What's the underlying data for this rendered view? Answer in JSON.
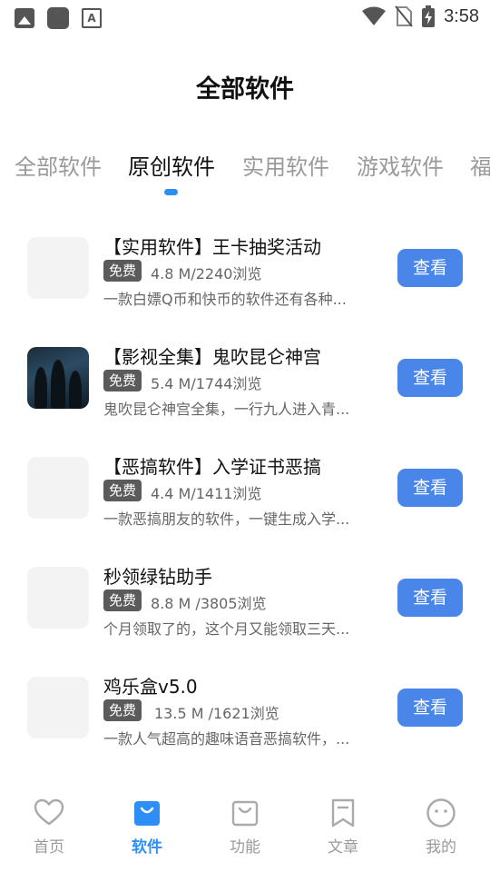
{
  "status_bar": {
    "time": "3:58",
    "left_icons": [
      "image-icon",
      "square-icon",
      "font-icon"
    ],
    "right_icons": [
      "wifi-icon",
      "no-sim-icon",
      "battery-charging-icon"
    ]
  },
  "header": {
    "title": "全部软件"
  },
  "tabs": [
    {
      "label": "全部软件"
    },
    {
      "label": "原创软件",
      "active": true
    },
    {
      "label": "实用软件"
    },
    {
      "label": "游戏软件"
    },
    {
      "label": "福"
    }
  ],
  "items": [
    {
      "title": "【实用软件】王卡抽奖活动",
      "badge": "免费",
      "meta": "4.8 M/2240浏览",
      "desc": "一款白嫖Q币和快币的软件还有各种...",
      "button": "查看",
      "thumb": "placeholder"
    },
    {
      "title": "【影视全集】鬼吹昆仑神宫",
      "badge": "免费",
      "meta": "5.4 M/1744浏览",
      "desc": "鬼吹昆仑神宫全集，一行九人进入青...",
      "button": "查看",
      "thumb": "poster"
    },
    {
      "title": "【恶搞软件】入学证书恶搞",
      "badge": "免费",
      "meta": "4.4 M/1411浏览",
      "desc": "一款恶搞朋友的软件，一键生成入学...",
      "button": "查看",
      "thumb": "placeholder"
    },
    {
      "title": "秒领绿钻助手",
      "badge": "免费",
      "meta": "8.8 M /3805浏览",
      "desc": "个月领取了的，这个月又能领取三天...",
      "button": "查看",
      "thumb": "placeholder"
    },
    {
      "title": "鸡乐盒v5.0",
      "badge": "免费",
      "meta": "13.5 M /1621浏览",
      "desc": "一款人气超高的趣味语音恶搞软件，...",
      "button": "查看",
      "thumb": "placeholder"
    }
  ],
  "bottom_nav": [
    {
      "label": "首页",
      "icon": "heart-icon"
    },
    {
      "label": "软件",
      "icon": "shopping-bag-icon",
      "active": true
    },
    {
      "label": "功能",
      "icon": "bag-icon"
    },
    {
      "label": "文章",
      "icon": "bookmark-icon"
    },
    {
      "label": "我的",
      "icon": "smiley-icon"
    }
  ],
  "colors": {
    "accent": "#2d8ef5",
    "button": "#4a86ea",
    "badge": "#5b5b5b"
  }
}
